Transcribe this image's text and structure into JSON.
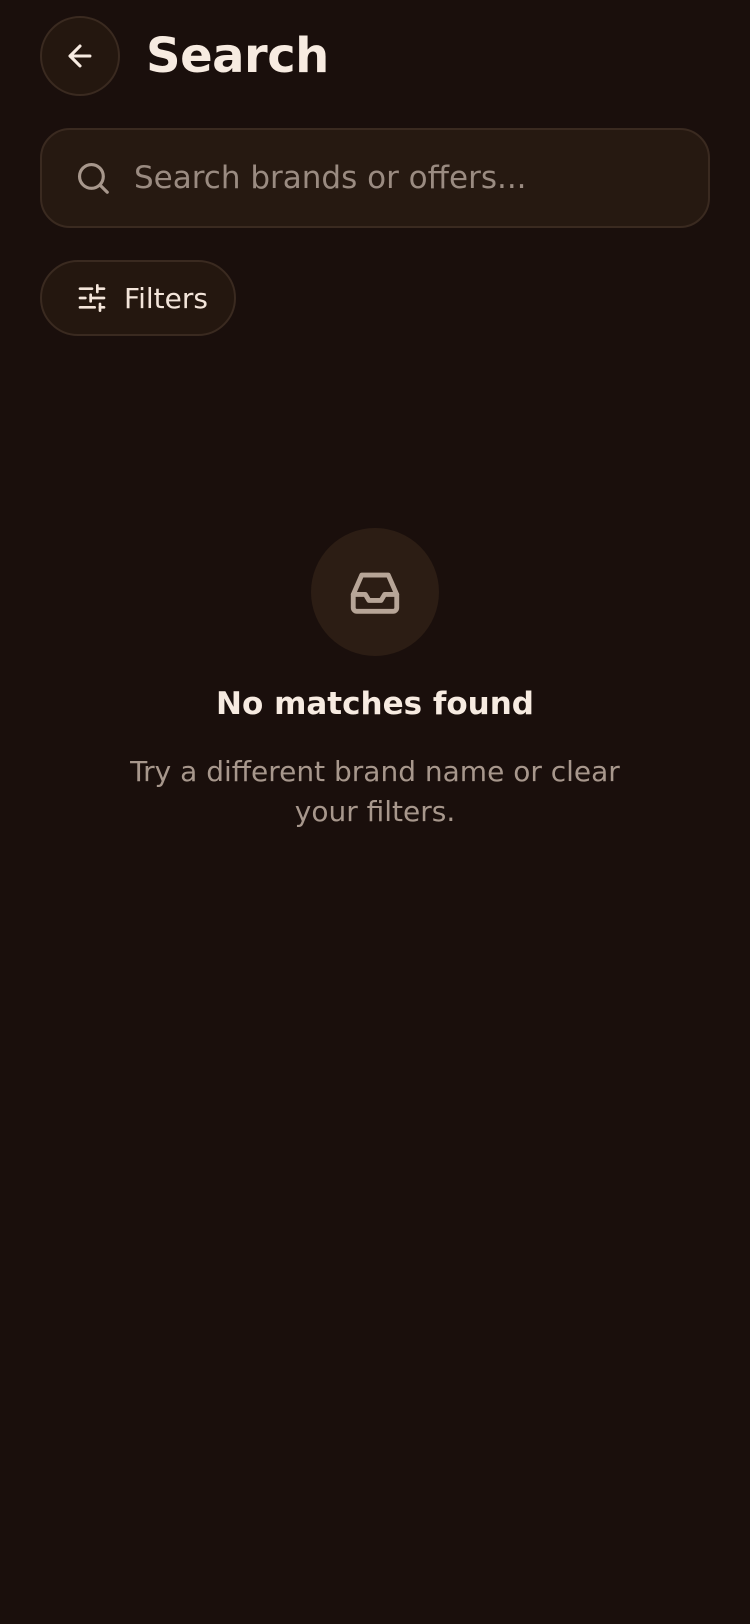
{
  "header": {
    "back_icon": "arrow-left-icon",
    "title": "Search"
  },
  "search": {
    "icon": "search-icon",
    "placeholder": "Search brands or offers...",
    "value": ""
  },
  "filters": {
    "icon": "sliders-icon",
    "label": "Filters"
  },
  "empty_state": {
    "icon": "inbox-icon",
    "title": "No matches found",
    "message": "Try a different brand name or clear your filters."
  },
  "colors": {
    "background": "#1a0f0c",
    "surface": "#261911",
    "border": "#3a2a20",
    "text_primary": "#f7ebe1",
    "text_muted": "#a7978c"
  }
}
